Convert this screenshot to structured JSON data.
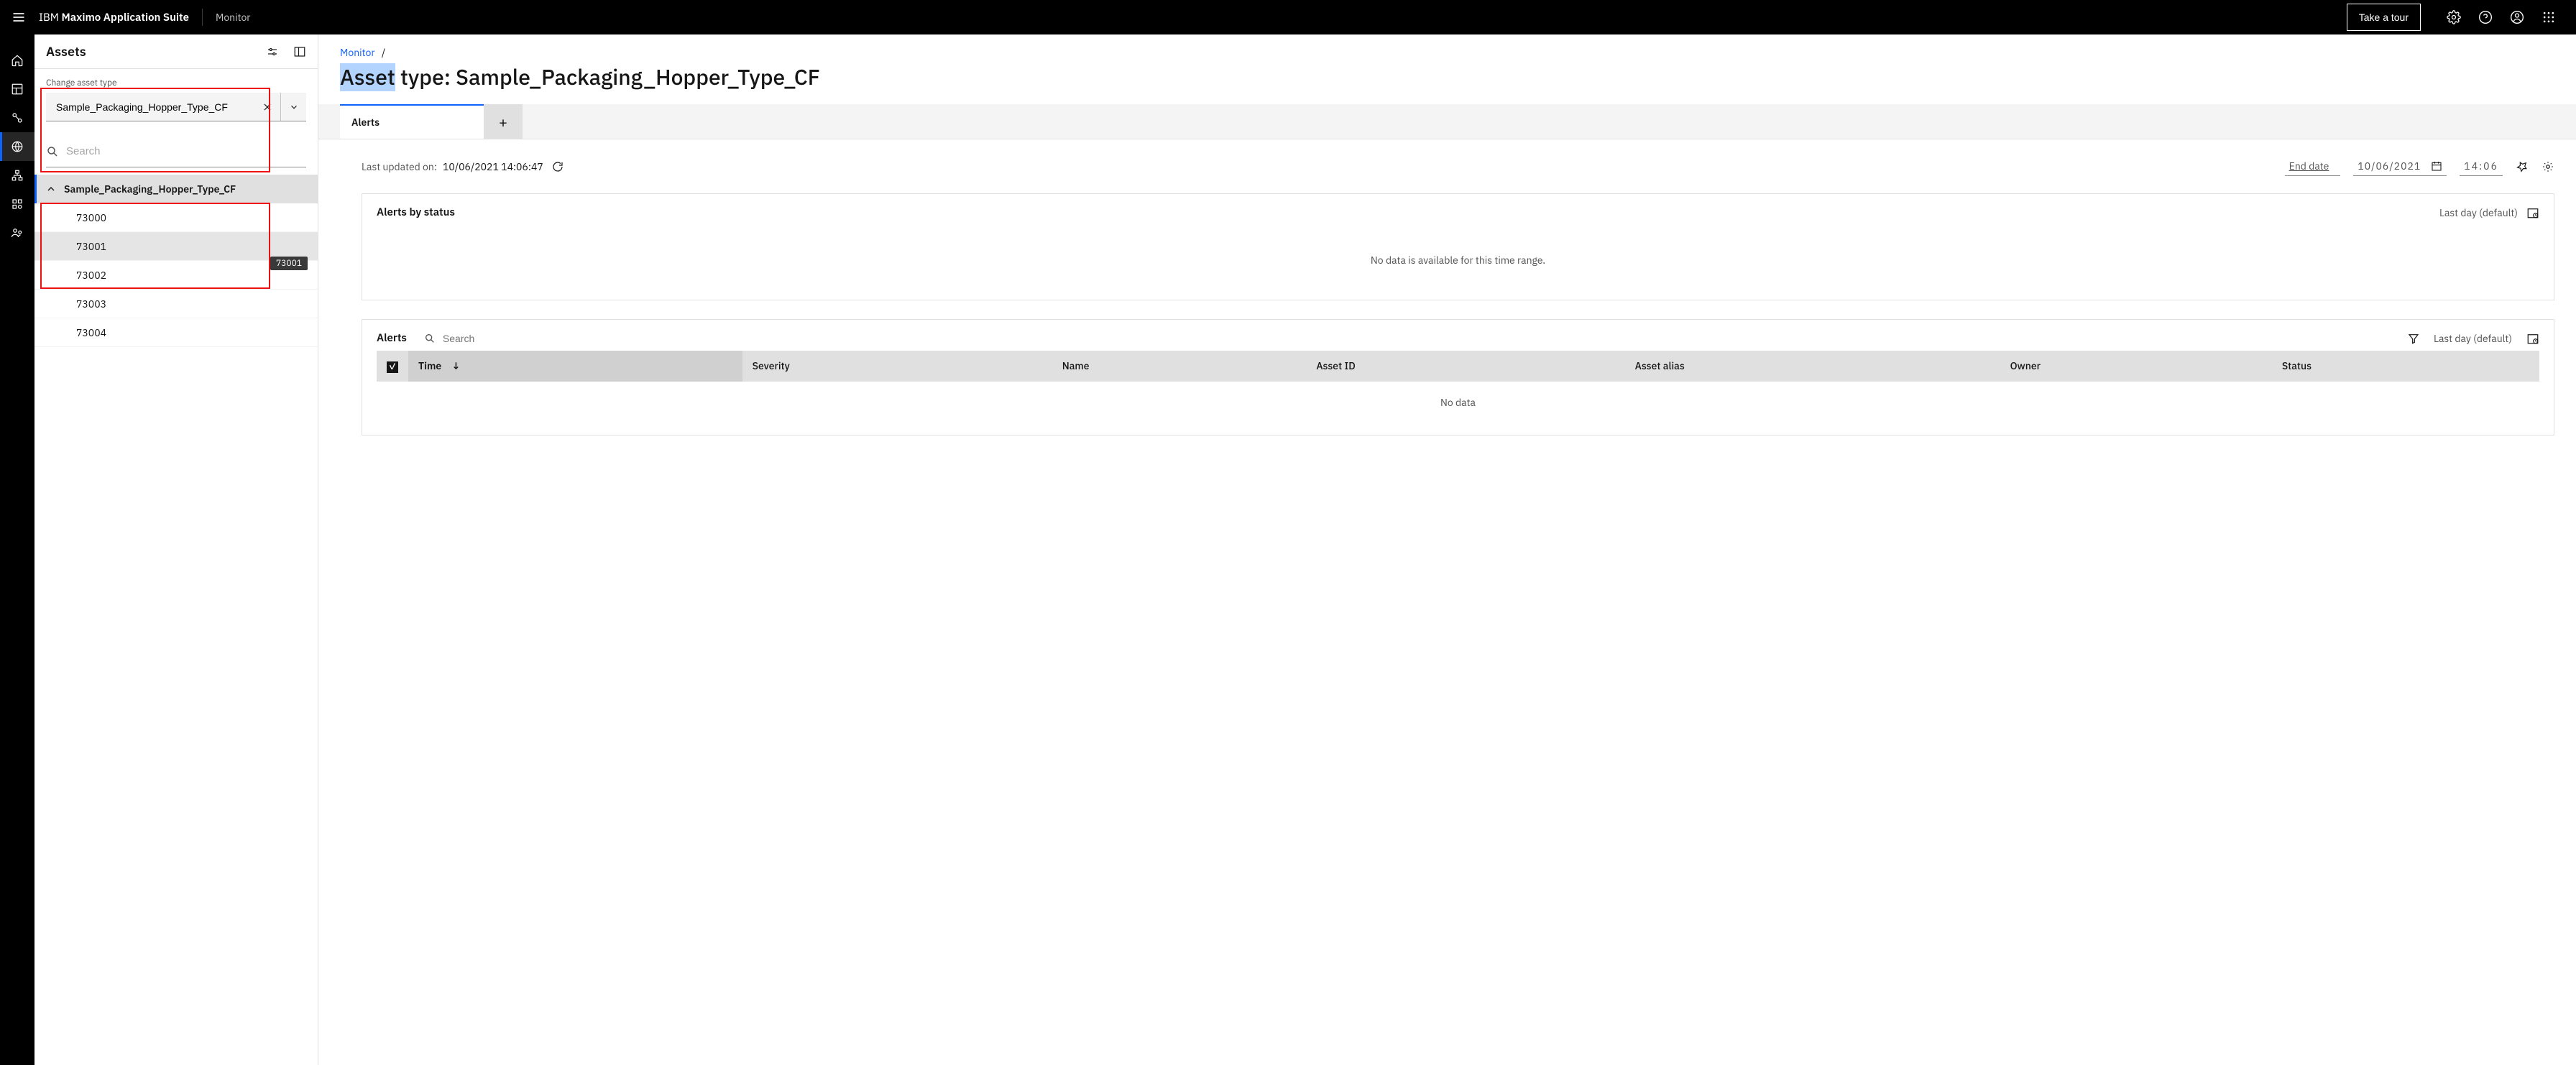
{
  "header": {
    "brand_prefix": "IBM ",
    "brand_bold": "Maximo Application Suite",
    "app_name": "Monitor",
    "tour_button": "Take a tour"
  },
  "sidebar": {
    "title": "Assets",
    "change_label": "Change asset type",
    "combo_value": "Sample_Packaging_Hopper_Type_CF",
    "search_placeholder": "Search",
    "tree_root": "Sample_Packaging_Hopper_Type_CF",
    "items": [
      "73000",
      "73001",
      "73002",
      "73003",
      "73004"
    ],
    "hover_index": 1,
    "tooltip_on_index": 1,
    "tooltip_text": "73001"
  },
  "main": {
    "breadcrumb_link": "Monitor",
    "breadcrumb_sep": "/",
    "title_highlight": "Asset",
    "title_rest": " type: Sample_Packaging_Hopper_Type_CF",
    "tab_label": "Alerts",
    "updated_label": "Last updated on:",
    "updated_value": "10/06/2021 14:06:47",
    "end_date_label": "End date",
    "end_date_value": "10/06/2021",
    "time_value": "14:06",
    "alerts_card_title": "Alerts by status",
    "range_text": "Last day (default)",
    "no_data_range": "No data is available for this time range.",
    "table_title": "Alerts",
    "table_search_placeholder": "Search",
    "columns": [
      "Time",
      "Severity",
      "Name",
      "Asset ID",
      "Asset alias",
      "Owner",
      "Status"
    ],
    "table_no_data": "No data"
  }
}
